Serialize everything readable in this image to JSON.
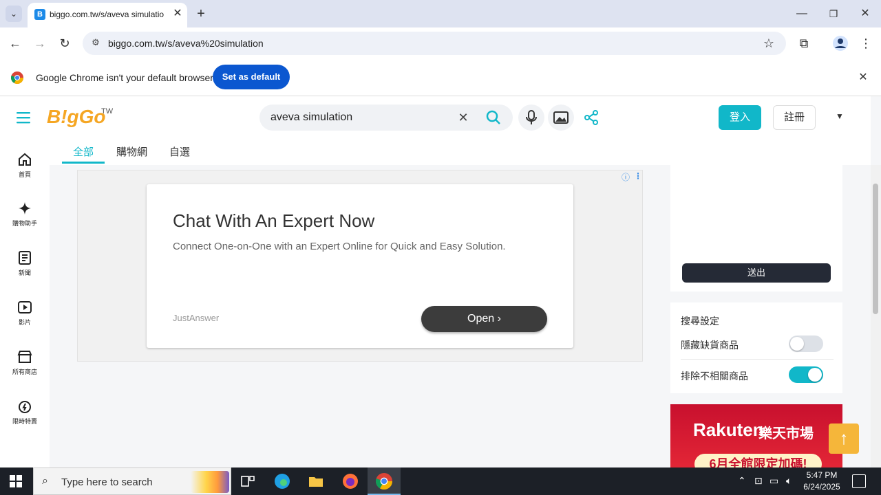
{
  "browser": {
    "tab_title": "biggo.com.tw/s/aveva simulatio",
    "tab_favicon": "B",
    "url": "biggo.com.tw/s/aveva%20simulation",
    "infobar_message": "Google Chrome isn't your default browser",
    "infobar_button": "Set as default"
  },
  "site": {
    "logo": "B!gGo",
    "logo_region": "TW",
    "search_query": "aveva simulation",
    "login_label": "登入",
    "register_label": "註冊",
    "tabs": [
      "全部",
      "購物網",
      "自選"
    ],
    "nav": [
      {
        "label": "首頁",
        "icon": "home-icon"
      },
      {
        "label": "購物助手",
        "icon": "sparkle-icon"
      },
      {
        "label": "新聞",
        "icon": "news-icon"
      },
      {
        "label": "影片",
        "icon": "video-icon"
      },
      {
        "label": "所有商店",
        "icon": "store-icon"
      },
      {
        "label": "限時特賣",
        "icon": "flash-sale-icon"
      }
    ]
  },
  "ad": {
    "headline": "Chat With An Expert Now",
    "description": "Connect One-on-One with an Expert Online for Quick and Easy Solution.",
    "source": "JustAnswer",
    "cta": "Open"
  },
  "sidebar": {
    "submit_label": "送出",
    "settings_title": "搜尋設定",
    "settings": [
      {
        "label": "隱藏缺貨商品",
        "enabled": false
      },
      {
        "label": "排除不相關商品",
        "enabled": true
      }
    ],
    "banner_brand": "Rakuten",
    "banner_brand_cn": "樂天市場",
    "banner_promo": "6月全館限定加碼!"
  },
  "taskbar": {
    "search_placeholder": "Type here to search",
    "time": "5:47 PM",
    "date": "6/24/2025"
  },
  "colors": {
    "accent": "#11b7c9",
    "chrome_blue": "#0b57d0",
    "toggle_on": "#11b7c9",
    "toggle_off": "#dde1e7"
  }
}
